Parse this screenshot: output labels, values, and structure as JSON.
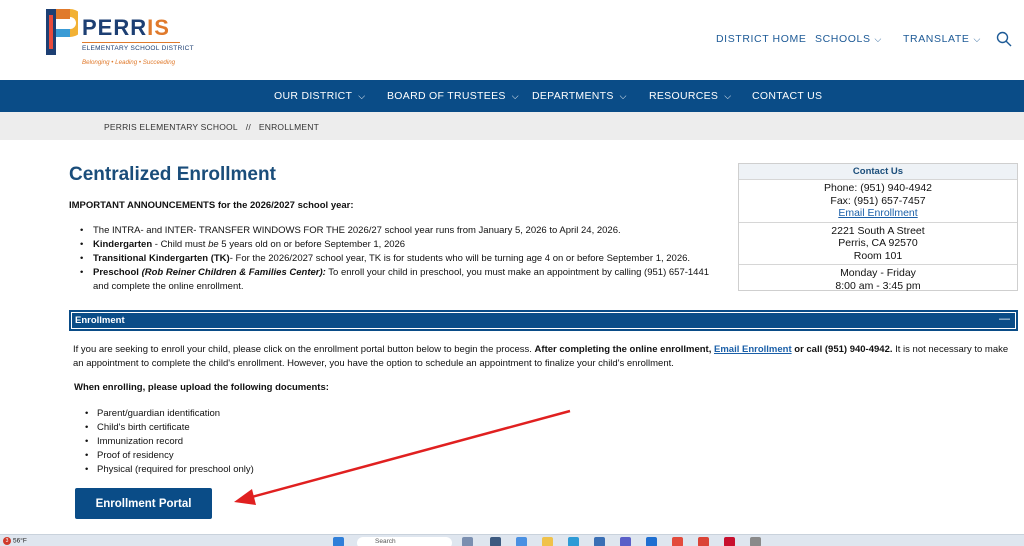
{
  "logo": {
    "name": "PERRIS",
    "name_a": "PERR",
    "name_b": "IS",
    "subtitle": "ELEMENTARY SCHOOL DISTRICT",
    "tagline": "Belonging • Leading • Succeeding"
  },
  "top_nav": {
    "district_home": "DISTRICT HOME",
    "schools": "SCHOOLS",
    "translate": "TRANSLATE"
  },
  "main_nav": {
    "our_district": "OUR DISTRICT",
    "board": "BOARD OF TRUSTEES",
    "departments": "DEPARTMENTS",
    "resources": "RESOURCES",
    "contact": "CONTACT US"
  },
  "breadcrumb": {
    "home": "PERRIS ELEMENTARY SCHOOL",
    "separator": "//",
    "current": "ENROLLMENT"
  },
  "page": {
    "title": "Centralized Enrollment",
    "announce_title": "IMPORTANT ANNOUNCEMENTS for the 2026/2027 school year:",
    "ann1": "The INTRA- and INTER- TRANSFER WINDOWS FOR THE 2026/27 school year runs from January 5, 2026 to April 24, 2026.",
    "ann2_bold": "Kindergarten",
    "ann2_a": " - Child must ",
    "ann2_em": "be",
    "ann2_b": " 5 years old on or before September 1, 2026",
    "ann3_bold": "Transitional Kindergarten (TK)",
    "ann3_rest": "- For the 2026/2027 school year, TK is for students who will be turning age 4 on or before September 1, 2026.",
    "ann4_bold": "Preschool",
    "ann4_em": "(Rob Reiner Children & Families Center):",
    "ann4_rest": " To enroll your child in preschool, you must make an appointment by calling (951) 657-1441 and complete the online enrollment."
  },
  "contact_box": {
    "heading": "Contact Us",
    "phone": "Phone: (951) 940-4942",
    "fax": "Fax: (951) 657-7457",
    "email_link": "Email Enrollment",
    "street": "2221 South A Street",
    "city": "Perris, CA 92570",
    "room": "Room 101",
    "days": "Monday - Friday",
    "hours": "8:00 am - 3:45 pm"
  },
  "enrollment": {
    "accordion_label": "Enrollment",
    "collapse_symbol": "—",
    "p1": "If you are seeking to enroll your child, please click on the enrollment portal button below to begin the process. ",
    "p_bold1": "After completing the online enrollment, ",
    "p_link": "Email Enrollment",
    "p_bold2": " or call (951) 940-4942.",
    "p2": " It is not necessary to make an appointment to complete the child's enrollment. However, you have the option to schedule an appointment to finalize your child's enrollment.",
    "upload_title": "When enrolling, please upload the following documents:",
    "docs": [
      "Parent/guardian identification",
      "Child's birth certificate",
      "Immunization record",
      "Proof of residency",
      "Physical (required for preschool only)"
    ],
    "portal_button": "Enrollment Portal"
  },
  "taskbar": {
    "weather_badge": "3",
    "temperature": "56°F",
    "search_placeholder": "Search"
  },
  "colors": {
    "nav_blue": "#0a4c87",
    "title_blue": "#1a4d7a",
    "accent_orange": "#e07a2c",
    "arrow_red": "#e02020"
  }
}
